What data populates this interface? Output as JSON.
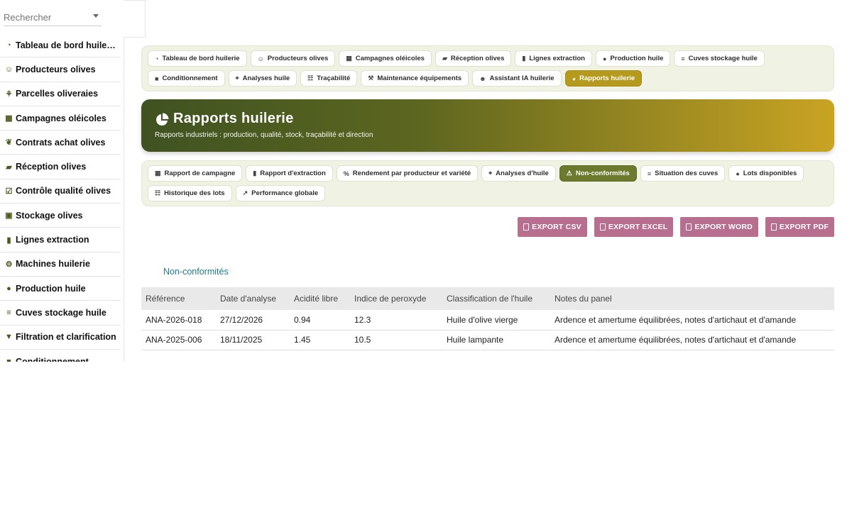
{
  "search": {
    "placeholder": "Rechercher"
  },
  "sidebar": {
    "items": [
      {
        "label": "Tableau de bord huilerie",
        "icon": "dashboard-icon"
      },
      {
        "label": "Producteurs olives",
        "icon": "users-icon"
      },
      {
        "label": "Parcelles oliveraies",
        "icon": "seedling-icon"
      },
      {
        "label": "Campagnes oléicoles",
        "icon": "calendar-icon"
      },
      {
        "label": "Contrats achat olives",
        "icon": "handshake-icon"
      },
      {
        "label": "Réception olives",
        "icon": "truck-icon"
      },
      {
        "label": "Contrôle qualité olives",
        "icon": "clipboard-check-icon"
      },
      {
        "label": "Stockage olives",
        "icon": "boxes-icon"
      },
      {
        "label": "Lignes extraction",
        "icon": "industry-icon"
      },
      {
        "label": "Machines huilerie",
        "icon": "cogs-icon"
      },
      {
        "label": "Production huile",
        "icon": "drop-icon"
      },
      {
        "label": "Cuves stockage huile",
        "icon": "database-icon"
      },
      {
        "label": "Filtration et clarification",
        "icon": "filter-icon"
      },
      {
        "label": "Conditionnement",
        "icon": "box-icon"
      }
    ]
  },
  "topnav": {
    "row1": [
      {
        "label": "Tableau de bord huilerie",
        "icon": "dashboard-icon"
      },
      {
        "label": "Producteurs olives",
        "icon": "users-icon"
      },
      {
        "label": "Campagnes oléicoles",
        "icon": "calendar-icon"
      },
      {
        "label": "Réception olives",
        "icon": "truck-icon"
      },
      {
        "label": "Lignes extraction",
        "icon": "industry-icon"
      },
      {
        "label": "Production huile",
        "icon": "drop-icon"
      },
      {
        "label": "Cuves stockage huile",
        "icon": "database-icon"
      }
    ],
    "row2": [
      {
        "label": "Conditionnement",
        "icon": "box-icon"
      },
      {
        "label": "Analyses huile",
        "icon": "microscope-icon"
      },
      {
        "label": "Traçabilité",
        "icon": "sitemap-icon"
      },
      {
        "label": "Maintenance équipements",
        "icon": "tools-icon"
      },
      {
        "label": "Assistant IA huilerie",
        "icon": "robot-icon"
      },
      {
        "label": "Rapports huilerie",
        "icon": "chart-pie-icon",
        "active": true
      }
    ]
  },
  "hero": {
    "title": "Rapports huilerie",
    "subtitle": "Rapports industriels : production, qualité, stock, traçabilité et direction"
  },
  "subnav": {
    "row1": [
      {
        "label": "Rapport de campagne",
        "icon": "calendar-icon"
      },
      {
        "label": "Rapport d'extraction",
        "icon": "industry-icon"
      },
      {
        "label": "Rendement par producteur et variété",
        "icon": "percent-icon"
      },
      {
        "label": "Analyses d'huile",
        "icon": "microscope-icon"
      },
      {
        "label": "Non-conformités",
        "icon": "warning-icon",
        "active": true
      },
      {
        "label": "Situation des cuves",
        "icon": "database-icon"
      },
      {
        "label": "Lots disponibles",
        "icon": "drop-icon"
      }
    ],
    "row2": [
      {
        "label": "Historique des lots",
        "icon": "sitemap-icon"
      },
      {
        "label": "Performance globale",
        "icon": "chart-line-icon"
      }
    ]
  },
  "exports": [
    {
      "label": "EXPORT CSV"
    },
    {
      "label": "EXPORT EXCEL"
    },
    {
      "label": "EXPORT WORD"
    },
    {
      "label": "EXPORT PDF"
    }
  ],
  "section": {
    "title": "Non-conformités"
  },
  "table": {
    "headers": [
      "Référence",
      "Date d'analyse",
      "Acidité libre",
      "Indice de peroxyde",
      "Classification de l'huile",
      "Notes du panel"
    ],
    "rows": [
      [
        "ANA-2026-018",
        "27/12/2026",
        "0.94",
        "12.3",
        "Huile d'olive vierge",
        "Ardence et amertume équilibrées, notes d'artichaut et d'amande"
      ],
      [
        "ANA-2025-006",
        "18/11/2025",
        "1.45",
        "10.5",
        "Huile lampante",
        "Ardence et amertume équilibrées, notes d'artichaut et d'amande"
      ]
    ]
  },
  "colors": {
    "accent_gold": "#b59a1e",
    "accent_olive": "#6b7a2c",
    "export_button": "#b86f8f",
    "section_title": "#1f7a8c"
  }
}
